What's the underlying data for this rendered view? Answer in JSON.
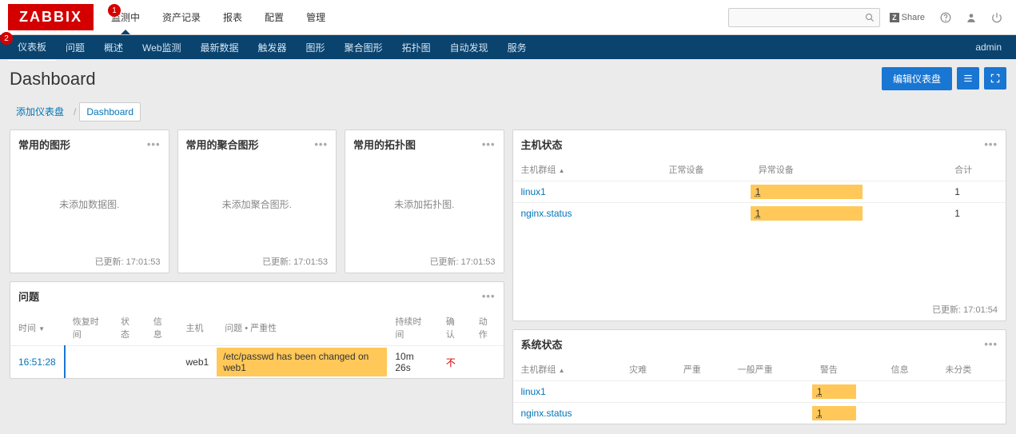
{
  "badges": {
    "b1": "1",
    "b2": "2"
  },
  "logo": "ZABBIX",
  "topMenu": [
    "监测中",
    "资产记录",
    "报表",
    "配置",
    "管理"
  ],
  "share": "Share",
  "subNav": [
    "仪表板",
    "问题",
    "概述",
    "Web监测",
    "最新数据",
    "触发器",
    "图形",
    "聚合图形",
    "拓扑图",
    "自动发现",
    "服务"
  ],
  "userLabel": "admin",
  "pageTitle": "Dashboard",
  "editBtn": "编辑仪表盘",
  "breadcrumb": {
    "add": "添加仪表盘",
    "current": "Dashboard"
  },
  "w1": {
    "title": "常用的图形",
    "empty": "未添加数据图.",
    "footer": "已更新: 17:01:53"
  },
  "w2": {
    "title": "常用的聚合图形",
    "empty": "未添加聚合图形.",
    "footer": "已更新: 17:01:53"
  },
  "w3": {
    "title": "常用的拓扑图",
    "empty": "未添加拓扑图.",
    "footer": "已更新: 17:01:53"
  },
  "problems": {
    "title": "问题",
    "headers": {
      "time": "时间",
      "recovery": "恢复时间",
      "status": "状态",
      "info": "信息",
      "host": "主机",
      "problem": "问题 • 严重性",
      "duration": "持续时间",
      "ack": "确认",
      "action": "动作"
    },
    "row": {
      "time": "16:51:28",
      "host": "web1",
      "problem": "/etc/passwd has been changed on web1",
      "duration": "10m 26s",
      "ack": "不"
    }
  },
  "hostStatus": {
    "title": "主机状态",
    "headers": {
      "group": "主机群组",
      "ok": "正常设备",
      "fail": "异常设备",
      "total": "合计"
    },
    "rows": [
      {
        "group": "linux1",
        "fail": "1",
        "total": "1"
      },
      {
        "group": "nginx.status",
        "fail": "1",
        "total": "1"
      }
    ],
    "footer": "已更新: 17:01:54"
  },
  "sysStatus": {
    "title": "系统状态",
    "headers": {
      "group": "主机群组",
      "disaster": "灾难",
      "high": "严重",
      "average": "一般严重",
      "warning": "警告",
      "info": "信息",
      "unclassified": "未分类"
    },
    "rows": [
      {
        "group": "linux1",
        "warning": "1"
      },
      {
        "group": "nginx.status",
        "warning": "1"
      }
    ]
  }
}
